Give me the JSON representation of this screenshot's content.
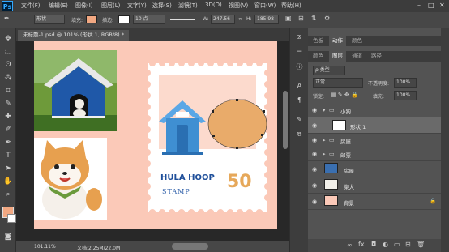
{
  "app": {
    "logo": "Ps"
  },
  "menu": [
    "文件(F)",
    "编辑(E)",
    "图像(I)",
    "图层(L)",
    "文字(Y)",
    "选择(S)",
    "滤镜(T)",
    "3D(D)",
    "视图(V)",
    "窗口(W)",
    "帮助(H)"
  ],
  "options": {
    "shape_mode": "形状",
    "fill_label": "填充:",
    "stroke_label": "描边:",
    "stroke_width": "10 点",
    "w_label": "W:",
    "w_value": "247.56",
    "link": "∞",
    "h_label": "H:",
    "h_value": "185.98"
  },
  "document": {
    "tab_title": "未标题-1.psd @ 101% (形状 1, RGB/8) *",
    "zoom": "101.11%",
    "doc_info": "文档:2.25M/22.0M"
  },
  "artwork": {
    "stamp_title": "HULA HOOP",
    "stamp_sub": "STAMP",
    "stamp_value": "50"
  },
  "panels": {
    "top_tabs": [
      "色板",
      "动作",
      "颜色"
    ],
    "adjust_tabs": [
      "颜色",
      "图层",
      "通道",
      "路径"
    ],
    "filter_kind": "ρ 类型",
    "blend_mode": "正常",
    "opacity_label": "不透明度:",
    "opacity_value": "100%",
    "lock_label": "锁定:",
    "fill_label": "填充:",
    "fill_value": "100%"
  },
  "layers": [
    {
      "name": "小狗",
      "type": "group"
    },
    {
      "name": "形状 1",
      "type": "shape",
      "selected": true
    },
    {
      "name": "房屋",
      "type": "group"
    },
    {
      "name": "邮票",
      "type": "group"
    },
    {
      "name": "房屋",
      "type": "image"
    },
    {
      "name": "柴犬",
      "type": "image"
    },
    {
      "name": "背景",
      "type": "background",
      "locked": true
    }
  ],
  "colors": {
    "foreground": "#f2a882",
    "background": "#ffffff",
    "canvas": "#fbc9b8",
    "oval": "#e9ab6a",
    "house_blue": "#3f8fd2"
  }
}
